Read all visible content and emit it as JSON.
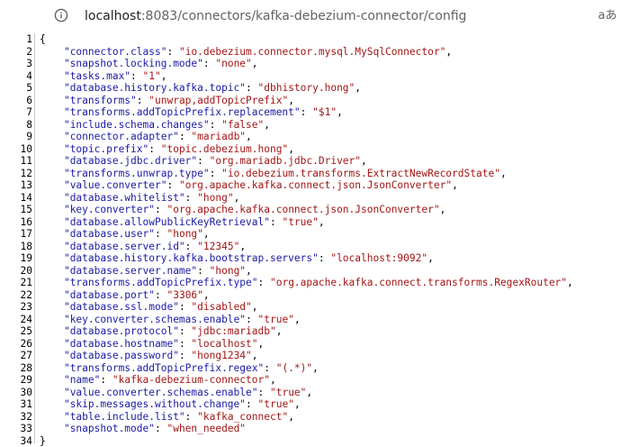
{
  "browser": {
    "url_host": "localhost",
    "url_rest": ":8083/connectors/kafka-debezium-connector/config",
    "translate_icon": "aあ"
  },
  "code": {
    "open_brace": "{",
    "close_brace": "}",
    "entries": [
      {
        "key": "\"connector.class\"",
        "value": "\"io.debezium.connector.mysql.MySqlConnector\""
      },
      {
        "key": "\"snapshot.locking.mode\"",
        "value": "\"none\""
      },
      {
        "key": "\"tasks.max\"",
        "value": "\"1\""
      },
      {
        "key": "\"database.history.kafka.topic\"",
        "value": "\"dbhistory.hong\""
      },
      {
        "key": "\"transforms\"",
        "value": "\"unwrap,addTopicPrefix\""
      },
      {
        "key": "\"transforms.addTopicPrefix.replacement\"",
        "value": "\"$1\""
      },
      {
        "key": "\"include.schema.changes\"",
        "value": "\"false\""
      },
      {
        "key": "\"connector.adapter\"",
        "value": "\"mariadb\""
      },
      {
        "key": "\"topic.prefix\"",
        "value": "\"topic.debezium.hong\""
      },
      {
        "key": "\"database.jdbc.driver\"",
        "value": "\"org.mariadb.jdbc.Driver\""
      },
      {
        "key": "\"transforms.unwrap.type\"",
        "value": "\"io.debezium.transforms.ExtractNewRecordState\""
      },
      {
        "key": "\"value.converter\"",
        "value": "\"org.apache.kafka.connect.json.JsonConverter\""
      },
      {
        "key": "\"database.whitelist\"",
        "value": "\"hong\""
      },
      {
        "key": "\"key.converter\"",
        "value": "\"org.apache.kafka.connect.json.JsonConverter\""
      },
      {
        "key": "\"database.allowPublicKeyRetrieval\"",
        "value": "\"true\""
      },
      {
        "key": "\"database.user\"",
        "value": "\"hong\""
      },
      {
        "key": "\"database.server.id\"",
        "value": "\"12345\""
      },
      {
        "key": "\"database.history.kafka.bootstrap.servers\"",
        "value": "\"localhost:9092\""
      },
      {
        "key": "\"database.server.name\"",
        "value": "\"hong\""
      },
      {
        "key": "\"transforms.addTopicPrefix.type\"",
        "value": "\"org.apache.kafka.connect.transforms.RegexRouter\""
      },
      {
        "key": "\"database.port\"",
        "value": "\"3306\""
      },
      {
        "key": "\"database.ssl.mode\"",
        "value": "\"disabled\""
      },
      {
        "key": "\"key.converter.schemas.enable\"",
        "value": "\"true\""
      },
      {
        "key": "\"database.protocol\"",
        "value": "\"jdbc:mariadb\""
      },
      {
        "key": "\"database.hostname\"",
        "value": "\"localhost\""
      },
      {
        "key": "\"database.password\"",
        "value": "\"hong1234\""
      },
      {
        "key": "\"transforms.addTopicPrefix.regex\"",
        "value": "\"(.*)\""
      },
      {
        "key": "\"name\"",
        "value": "\"kafka-debezium-connector\""
      },
      {
        "key": "\"value.converter.schemas.enable\"",
        "value": "\"true\""
      },
      {
        "key": "\"skip.messages.without.change\"",
        "value": "\"true\""
      },
      {
        "key": "\"table.include.list\"",
        "value": "\"kafka_connect\""
      },
      {
        "key": "\"snapshot.mode\"",
        "value": "\"when_needed\"",
        "last": true
      }
    ]
  },
  "colors": {
    "key": "#1a1aa6",
    "value": "#a31515"
  }
}
